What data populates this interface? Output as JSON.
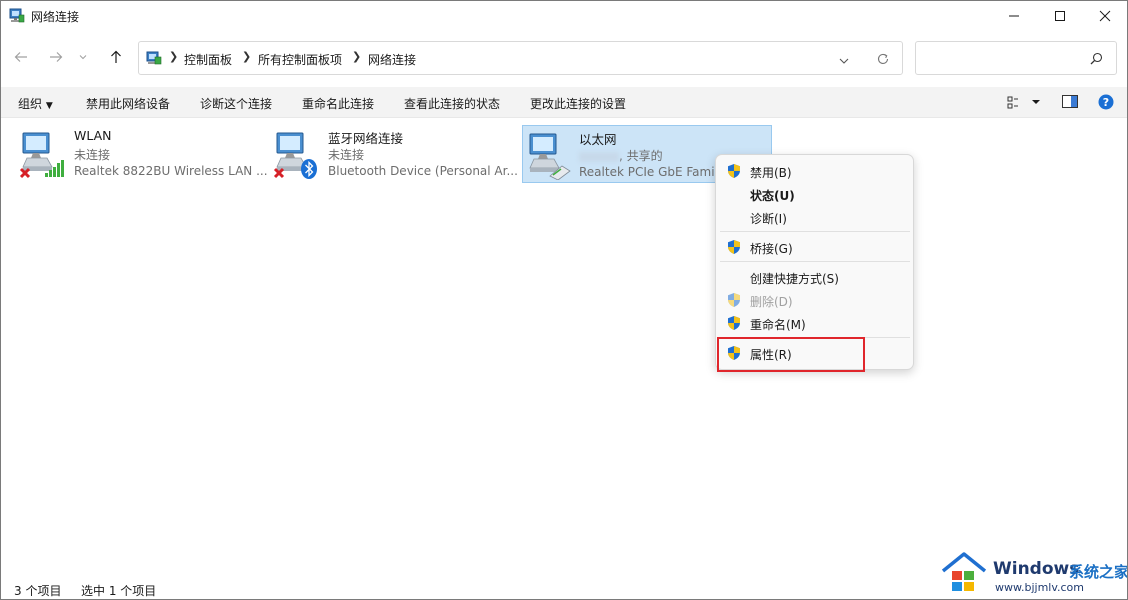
{
  "window": {
    "title": "网络连接"
  },
  "address": {
    "crumbs": [
      "控制面板",
      "所有控制面板项",
      "网络连接"
    ],
    "search_placeholder": ""
  },
  "commands": {
    "organize": "组织",
    "disable": "禁用此网络设备",
    "diagnose": "诊断这个连接",
    "rename": "重命名此连接",
    "view_status": "查看此连接的状态",
    "change_settings": "更改此连接的设置"
  },
  "items": [
    {
      "name": "WLAN",
      "status": "未连接",
      "device": "Realtek 8822BU Wireless LAN ..."
    },
    {
      "name": "蓝牙网络连接",
      "status": "未连接",
      "device": "Bluetooth Device (Personal Ar..."
    },
    {
      "name": "以太网",
      "status": ", 共享的",
      "device": "Realtek PCIe GbE Famil"
    }
  ],
  "context_menu": {
    "items": [
      {
        "label": "禁用(B)",
        "shield": true
      },
      {
        "label": "状态(U)",
        "shield": false,
        "bold": true
      },
      {
        "label": "诊断(I)",
        "shield": false
      },
      {
        "label": "桥接(G)",
        "shield": true
      },
      {
        "label": "创建快捷方式(S)",
        "shield": false
      },
      {
        "label": "删除(D)",
        "shield": true,
        "disabled": true
      },
      {
        "label": "重命名(M)",
        "shield": true
      },
      {
        "label": "属性(R)",
        "shield": true
      }
    ]
  },
  "status": {
    "count": "3 个项目",
    "selected": "选中 1 个项目"
  },
  "watermark": {
    "brand": "Windows",
    "cn": "系统之家",
    "url": "www.bjjmlv.com"
  },
  "colors": {
    "accent": "#0067c0",
    "selection": "#cce4f7",
    "highlight": "#e0262c"
  }
}
